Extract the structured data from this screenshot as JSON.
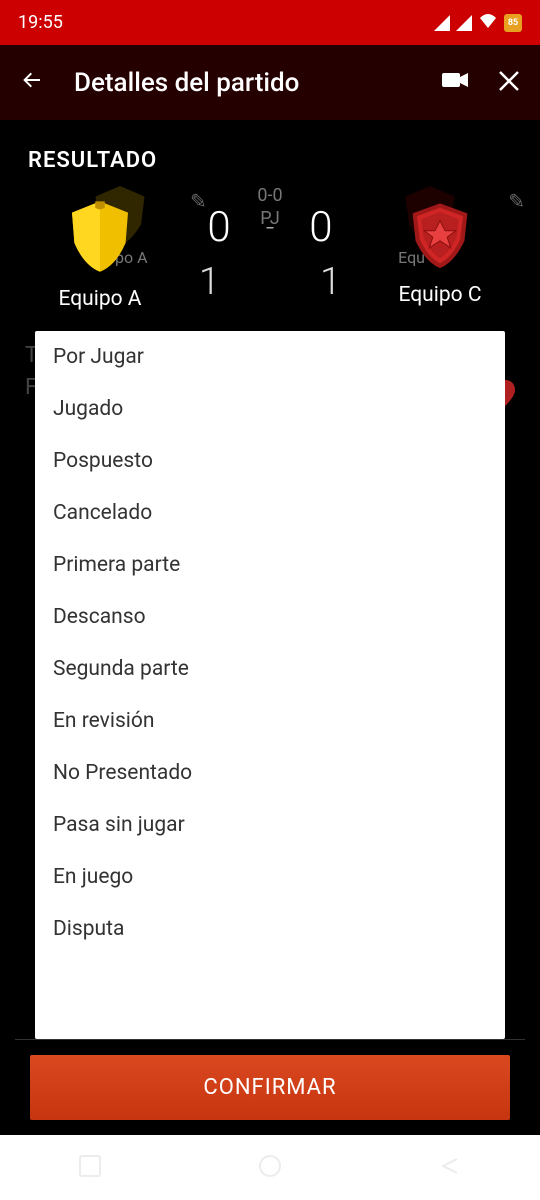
{
  "status": {
    "time": "19:55",
    "battery": "85"
  },
  "header": {
    "title": "Detalles del partido"
  },
  "background": {
    "score_line": "0-0",
    "pj": "PJ",
    "team_a_short": "po A",
    "team_c_short": "Equ",
    "tournament": "TO            CUP",
    "sport": "Fútbol"
  },
  "modal": {
    "title": "RESULTADO",
    "team_a": {
      "name": "Equipo A"
    },
    "team_c": {
      "name": "Equipo C"
    },
    "score_a": "0",
    "score_b": "0",
    "dash": "-",
    "sub_a": "1",
    "sub_b": "1",
    "options": [
      "Por Jugar",
      "Jugado",
      "Pospuesto",
      "Cancelado",
      "Primera parte",
      "Descanso",
      "Segunda parte",
      "En revisión",
      "No Presentado",
      "Pasa sin jugar",
      "En juego",
      "Disputa"
    ],
    "confirm": "CONFIRMAR"
  }
}
